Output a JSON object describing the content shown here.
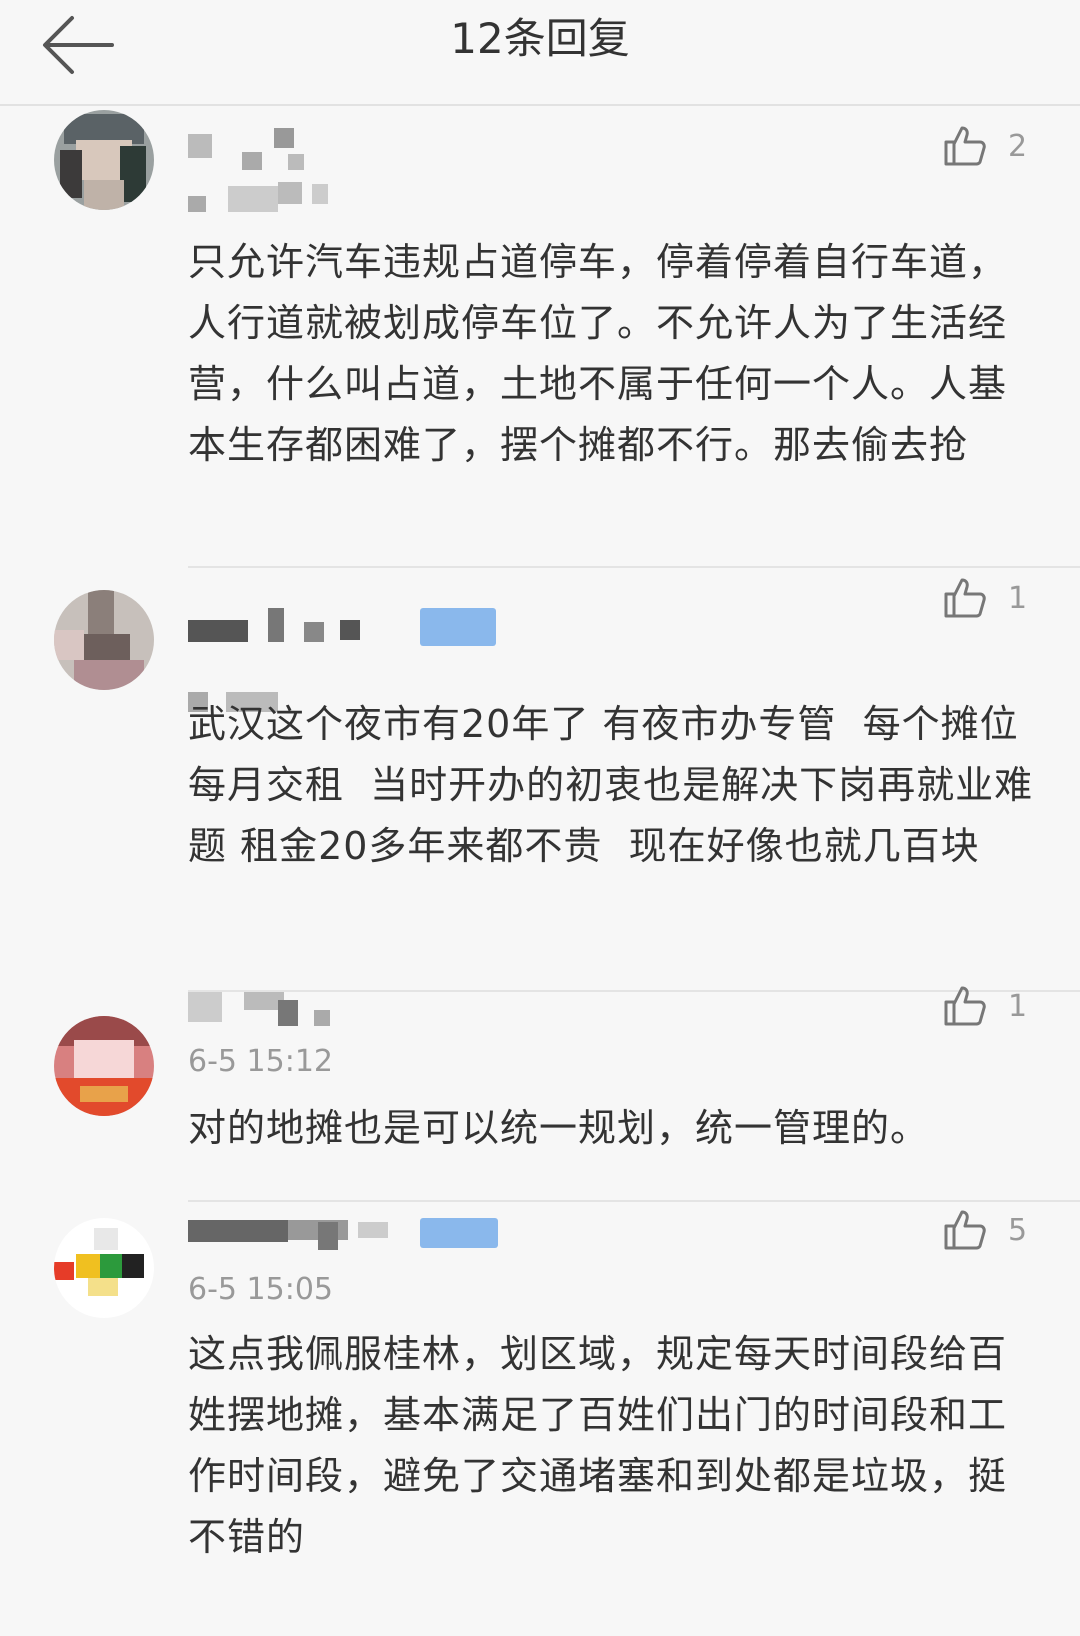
{
  "header": {
    "title": "12条回复"
  },
  "comments": [
    {
      "likes": "2",
      "text": "只允许汽车违规占道停车，停着停着自行车道，人行道就被划成停车位了。不允许人为了生活经营，什么叫占道，土地不属于任何一个人。人基本生存都困难了，摆个摊都不行。那去偷去抢"
    },
    {
      "likes": "1",
      "text": "武汉这个夜市有20年了 有夜市办专管  每个摊位每月交租  当时开办的初衷也是解决下岗再就业难题 租金20多年来都不贵  现在好像也就几百块"
    },
    {
      "likes": "1",
      "time": "6-5 15:12",
      "text": "对的地摊也是可以统一规划，统一管理的。"
    },
    {
      "likes": "5",
      "time": "6-5 15:05",
      "text": "这点我佩服桂林，划区域，规定每天时间段给百姓摆地摊，基本满足了百姓们出门的时间段和工作时间段，避免了交通堵塞和到处都是垃圾，挺不错的"
    }
  ],
  "icons": {
    "back": "arrow-left-icon",
    "like": "thumbs-up-icon"
  },
  "colors": {
    "background": "#f7f7f7",
    "text": "#333333",
    "meta": "#999999",
    "badge": "#8ab8ec"
  }
}
